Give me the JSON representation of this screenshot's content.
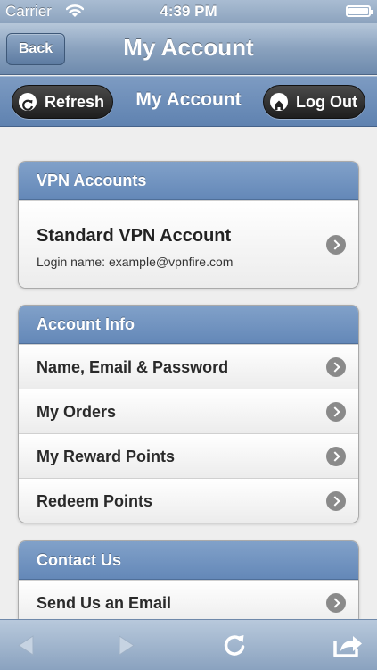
{
  "status_bar": {
    "carrier": "Carrier",
    "time": "4:39 PM"
  },
  "nav_bar": {
    "back_label": "Back",
    "title": "My Account"
  },
  "header": {
    "refresh_label": "Refresh",
    "title": "My Account",
    "logout_label": "Log Out"
  },
  "groups": [
    {
      "title": "VPN Accounts",
      "account": {
        "title": "Standard VPN Account",
        "subtitle": "Login name: example@vpnfire.com"
      }
    },
    {
      "title": "Account Info",
      "items": [
        {
          "label": "Name, Email & Password"
        },
        {
          "label": "My Orders"
        },
        {
          "label": "My Reward Points"
        },
        {
          "label": "Redeem Points"
        }
      ]
    },
    {
      "title": "Contact Us",
      "items": [
        {
          "label": "Send Us an Email"
        }
      ]
    }
  ],
  "toolbar": {
    "icons": [
      "back-arrow-icon",
      "forward-arrow-icon",
      "reload-icon",
      "share-icon"
    ]
  },
  "colors": {
    "header_blue": "#6488b8",
    "nav_blue": "#8aa2be",
    "chevron_gray": "#8a8a8a"
  }
}
